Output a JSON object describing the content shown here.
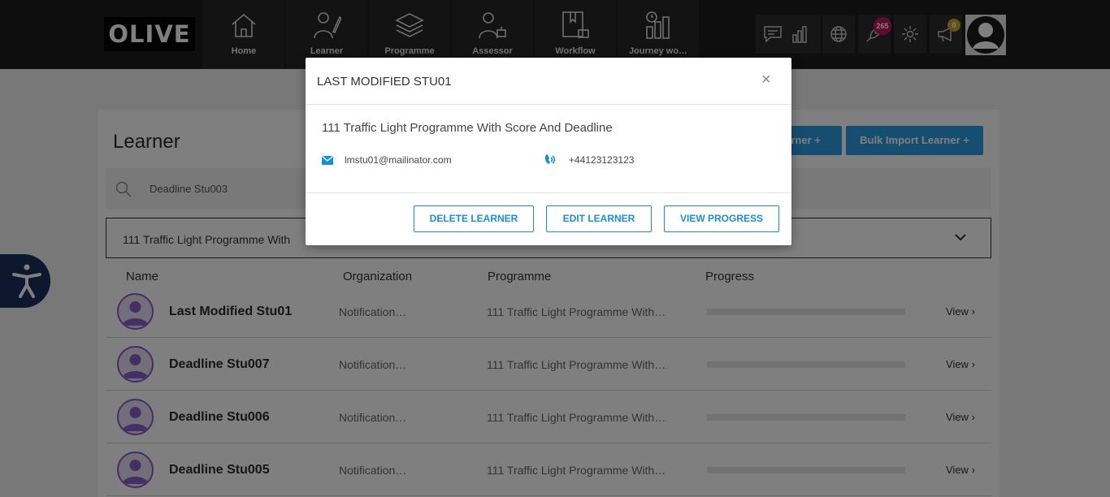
{
  "app": {
    "logo": "OLIVE"
  },
  "nav": {
    "tabs": [
      {
        "label": "Home",
        "icon": "home-icon"
      },
      {
        "label": "Learner",
        "icon": "learner-icon"
      },
      {
        "label": "Programme",
        "icon": "programme-icon"
      },
      {
        "label": "Assessor",
        "icon": "assessor-icon"
      },
      {
        "label": "Workflow",
        "icon": "workflow-icon"
      },
      {
        "label": "Journey wo…",
        "icon": "journey-icon"
      }
    ],
    "notification_count": "265",
    "announcement_count": "0"
  },
  "page": {
    "title": "Learner",
    "add_learner_label": "arner +",
    "bulk_import_label": "Bulk Import Learner +",
    "search_value": "Deadline Stu003",
    "filter_value": "111 Traffic Light Programme With"
  },
  "table": {
    "headers": {
      "name": "Name",
      "organization": "Organization",
      "programme": "Programme",
      "progress": "Progress"
    },
    "view_label": "View",
    "rows": [
      {
        "name": "Last Modified Stu01",
        "organization": "Notification…",
        "programme": "111 Traffic Light Programme With…"
      },
      {
        "name": "Deadline Stu007",
        "organization": "Notification…",
        "programme": "111 Traffic Light Programme With…"
      },
      {
        "name": "Deadline Stu006",
        "organization": "Notification…",
        "programme": "111 Traffic Light Programme With…"
      },
      {
        "name": "Deadline Stu005",
        "organization": "Notification…",
        "programme": "111 Traffic Light Programme With…"
      }
    ]
  },
  "modal": {
    "title": "LAST MODIFIED STU01",
    "close": "×",
    "programme": "111 Traffic Light Programme With Score And Deadline",
    "email": "lmstu01@mailinator.com",
    "phone": "+44123123123",
    "delete_label": "DELETE LEARNER",
    "edit_label": "EDIT LEARNER",
    "view_progress_label": "VIEW PROGRESS"
  },
  "colors": {
    "accent": "#2d9de2",
    "modal_button": "#1a8ed4",
    "avatar": "#8b5fcf",
    "topbar": "#1d1d1d"
  }
}
